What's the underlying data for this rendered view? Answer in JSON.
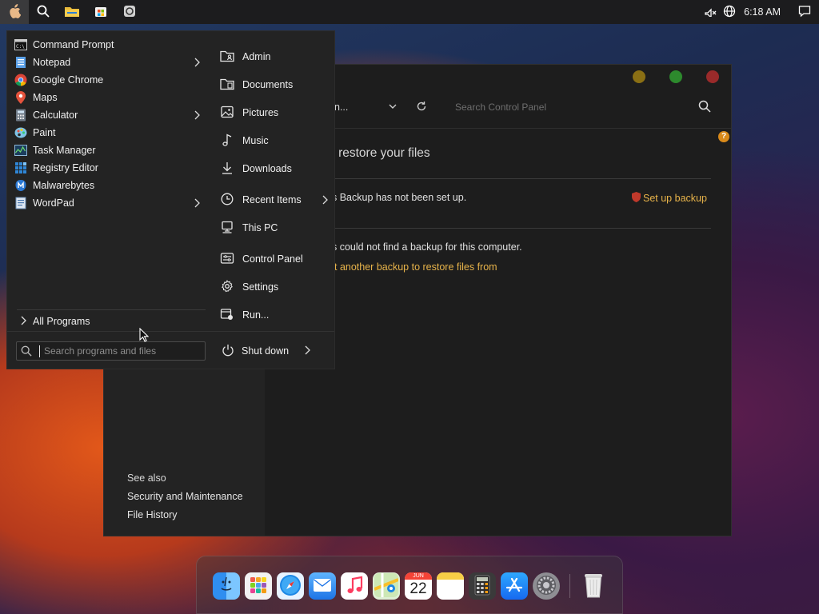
{
  "topbar": {
    "clock": "6:18 AM",
    "icons": [
      "apple-menu-icon",
      "search-icon",
      "file-explorer-icon",
      "store-icon",
      "app-icon",
      "network-muted-icon",
      "globe-icon",
      "notifications-icon"
    ]
  },
  "control_panel": {
    "address_text": "n...",
    "search_placeholder": "Search Control Panel",
    "heading": "or restore your files",
    "backup_status": "s Backup has not been set up.",
    "setup_link": "Set up backup",
    "no_backup_text": "s could not find a backup for this computer.",
    "select_link": "t another backup to restore files from",
    "see_also": {
      "title": "See also",
      "links": [
        "Security and Maintenance",
        "File History"
      ]
    }
  },
  "start_menu": {
    "programs": [
      {
        "label": "Command Prompt",
        "icon": "command-prompt-icon",
        "has_submenu": false
      },
      {
        "label": "Notepad",
        "icon": "notepad-icon",
        "has_submenu": true
      },
      {
        "label": "Google Chrome",
        "icon": "chrome-icon",
        "has_submenu": false
      },
      {
        "label": "Maps",
        "icon": "maps-icon",
        "has_submenu": false
      },
      {
        "label": "Calculator",
        "icon": "calculator-icon",
        "has_submenu": true
      },
      {
        "label": "Paint",
        "icon": "paint-icon",
        "has_submenu": false
      },
      {
        "label": "Task Manager",
        "icon": "task-manager-icon",
        "has_submenu": false
      },
      {
        "label": "Registry Editor",
        "icon": "registry-editor-icon",
        "has_submenu": false
      },
      {
        "label": "Malwarebytes",
        "icon": "malwarebytes-icon",
        "has_submenu": false
      },
      {
        "label": "WordPad",
        "icon": "wordpad-icon",
        "has_submenu": true
      }
    ],
    "all_programs": "All Programs",
    "search_placeholder": "Search programs and files",
    "places": [
      {
        "label": "Admin",
        "icon": "user-folder-icon"
      },
      {
        "label": "Documents",
        "icon": "document-icon"
      },
      {
        "label": "Pictures",
        "icon": "picture-icon"
      },
      {
        "label": "Music",
        "icon": "music-note-icon"
      },
      {
        "label": "Downloads",
        "icon": "download-icon"
      },
      {
        "label": "Recent Items",
        "icon": "clock-icon"
      },
      {
        "label": "This PC",
        "icon": "computer-icon"
      },
      {
        "label": "Control Panel",
        "icon": "control-panel-icon"
      },
      {
        "label": "Settings",
        "icon": "gear-icon"
      },
      {
        "label": "Run...",
        "icon": "run-icon"
      }
    ],
    "shutdown": "Shut down"
  },
  "dock": {
    "items": [
      "finder",
      "launchpad",
      "safari",
      "mail",
      "music",
      "maps",
      "calendar",
      "notes",
      "calculator",
      "app-store",
      "system-preferences",
      "trash"
    ],
    "calendar_month": "JUN",
    "calendar_day": "22"
  }
}
